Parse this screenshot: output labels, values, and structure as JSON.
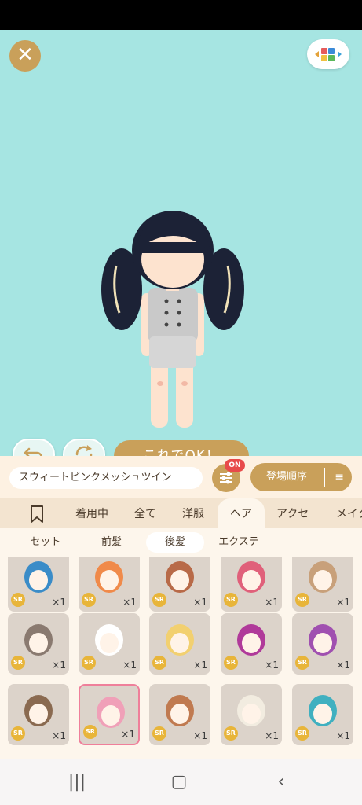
{
  "top": {
    "close_label": "✕"
  },
  "actions": {
    "ok_label": "これでOK！"
  },
  "filter": {
    "item_name": "スウィートピンクメッシュツイン",
    "filter_badge": "ON",
    "sort_label": "登場順序"
  },
  "tabs": [
    {
      "label": "着用中"
    },
    {
      "label": "全て"
    },
    {
      "label": "洋服"
    },
    {
      "label": "ヘア"
    },
    {
      "label": "アクセ"
    },
    {
      "label": "メイク"
    }
  ],
  "subtabs": [
    {
      "label": "セット"
    },
    {
      "label": "前髪"
    },
    {
      "label": "後髪"
    },
    {
      "label": "エクステ"
    }
  ],
  "grid": {
    "rarity": "SR",
    "count": "×1",
    "hair_colors": [
      "#3a8cc8",
      "#f08a4a",
      "#b86a48",
      "#e0607a",
      "#c8a07a",
      "#8a7a70",
      "#ffffff",
      "#f2d070",
      "#b03a9a",
      "#a050b0",
      "#8a6a50",
      "#f0a0b8",
      "#c07a50",
      "#f2ece0",
      "#40b0c0"
    ],
    "selected_index": 11
  }
}
